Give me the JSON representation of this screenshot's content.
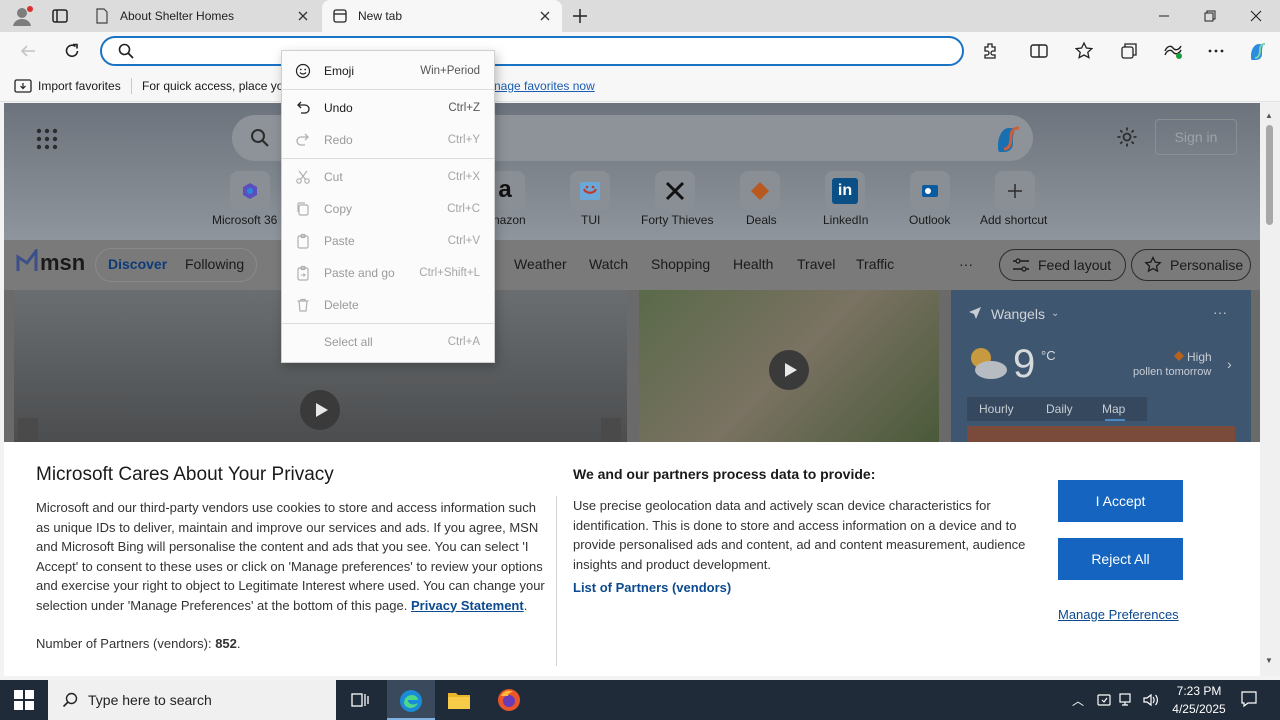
{
  "browser": {
    "tabs": [
      {
        "title": "About Shelter Homes"
      },
      {
        "title": "New tab"
      }
    ],
    "favorites_bar": {
      "import_label": "Import favorites",
      "quick_access_text": "For quick access, place you",
      "manage_link": "nage favorites now"
    }
  },
  "newtab": {
    "signin_label": "Sign in",
    "shortcuts": [
      {
        "label": "Microsoft 36"
      },
      {
        "label": "nazon"
      },
      {
        "label": "TUI"
      },
      {
        "label": "Forty Thieves"
      },
      {
        "label": "Deals"
      },
      {
        "label": "LinkedIn"
      },
      {
        "label": "Outlook"
      },
      {
        "label": "Add shortcut"
      }
    ],
    "msn": {
      "logo_text": "msn",
      "nav_primary": [
        "Discover",
        "Following"
      ],
      "nav_secondary": [
        "Weather",
        "Watch",
        "Shopping",
        "Health",
        "Travel",
        "Traffic"
      ],
      "feed_layout_label": "Feed layout",
      "personalise_label": "Personalise"
    },
    "weather": {
      "location": "Wangels",
      "temp": "9",
      "unit": "°C",
      "pollen_level": "High",
      "pollen_text": "pollen tomorrow",
      "tabs": [
        "Hourly",
        "Daily",
        "Map"
      ]
    }
  },
  "context_menu": {
    "items": [
      {
        "label": "Emoji",
        "shortcut": "Win+Period",
        "icon": "emoji-icon",
        "enabled": true
      },
      {
        "label": "Undo",
        "shortcut": "Ctrl+Z",
        "icon": "undo-icon",
        "enabled": true
      },
      {
        "label": "Redo",
        "shortcut": "Ctrl+Y",
        "icon": "redo-icon",
        "enabled": false
      },
      {
        "label": "Cut",
        "shortcut": "Ctrl+X",
        "icon": "cut-icon",
        "enabled": false
      },
      {
        "label": "Copy",
        "shortcut": "Ctrl+C",
        "icon": "copy-icon",
        "enabled": false
      },
      {
        "label": "Paste",
        "shortcut": "Ctrl+V",
        "icon": "paste-icon",
        "enabled": false
      },
      {
        "label": "Paste and go",
        "shortcut": "Ctrl+Shift+L",
        "icon": "paste-go-icon",
        "enabled": false
      },
      {
        "label": "Delete",
        "shortcut": "",
        "icon": "delete-icon",
        "enabled": false
      },
      {
        "label": "Select all",
        "shortcut": "Ctrl+A",
        "icon": "",
        "enabled": false
      }
    ]
  },
  "privacy": {
    "title": "Microsoft Cares About Your Privacy",
    "body": "Microsoft and our third-party vendors use cookies to store and access information such as unique IDs to deliver, maintain and improve our services and ads. If you agree, MSN and Microsoft Bing will personalise the content and ads that you see. You can select 'I Accept' to consent to these uses or click on 'Manage preferences' to review your options and exercise your right to object to Legitimate Interest where used.  You can change your selection under 'Manage Preferences' at the bottom of this page.",
    "privacy_link": "Privacy Statement",
    "partners_label": "Number of Partners (vendors):",
    "partners_count": "852",
    "right_title": "We and our partners process data to provide:",
    "right_body": "Use precise geolocation data and actively scan device characteristics for identification. This is done to store and access information on a device and to provide personalised ads and content, ad and content measurement, audience insights and product development.",
    "partners_list_link": "List of Partners (vendors)",
    "accept_label": "I Accept",
    "reject_label": "Reject All",
    "manage_label": "Manage Preferences"
  },
  "taskbar": {
    "search_placeholder": "Type here to search",
    "time": "7:23 PM",
    "date": "4/25/2025"
  },
  "colors": {
    "accent": "#1565c0",
    "taskbar": "#1f2b38"
  }
}
